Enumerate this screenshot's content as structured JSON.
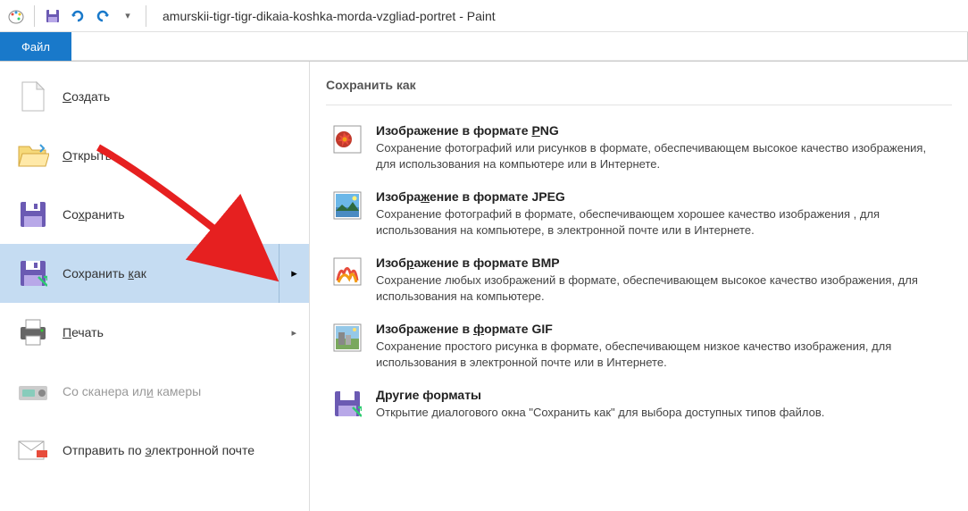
{
  "titlebar": {
    "title": "amurskii-tigr-tigr-dikaia-koshka-morda-vzgliad-portret - Paint"
  },
  "ribbon": {
    "file_tab": "Файл"
  },
  "file_menu": {
    "create": "Создать",
    "open": "Открыть",
    "save": "Сохранить",
    "save_as": "Сохранить как",
    "print": "Печать",
    "scanner": "Со сканера или камеры",
    "email": "Отправить по электронной почте"
  },
  "save_as_panel": {
    "header": "Сохранить как",
    "png_title": "Изображение в формате PNG",
    "png_desc": "Сохранение фотографий или рисунков в формате, обеспечивающем высокое качество изображения, для использования на компьютере или в Интернете.",
    "jpeg_title": "Изображение в формате JPEG",
    "jpeg_desc": "Сохранение фотографий в формате, обеспечивающем хорошее качество изображения , для использования на компьютере, в электронной почте или в Интернете.",
    "bmp_title": "Изображение в формате BMP",
    "bmp_desc": "Сохранение любых изображений в формате, обеспечивающем высокое качество изображения, для использования на компьютере.",
    "gif_title": "Изображение в формате GIF",
    "gif_desc": "Сохранение простого рисунка в формате, обеспечивающем низкое качество изображения, для использования в электронной почте или в Интернете.",
    "other_title": "Другие форматы",
    "other_desc": "Открытие диалогового окна \"Сохранить как\" для выбора доступных типов файлов."
  }
}
